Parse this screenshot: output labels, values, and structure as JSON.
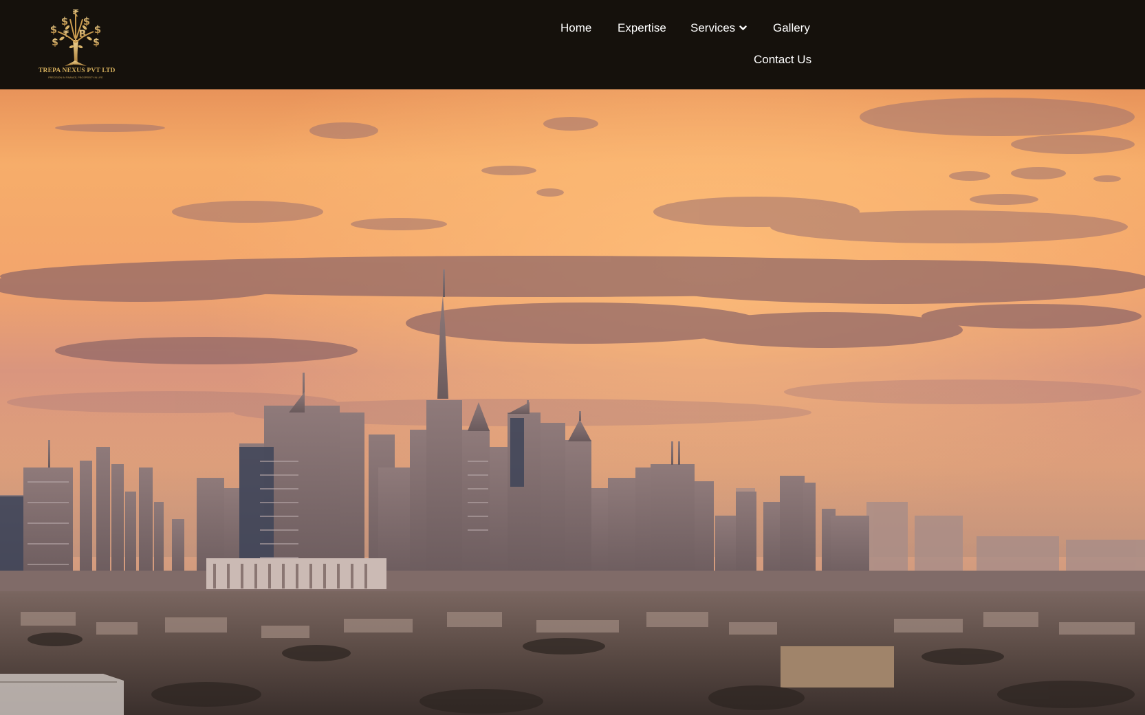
{
  "brand": {
    "name": "TREPA NEXUS PVT LTD",
    "tagline": "PRECISION IN FINANCE, PROSPERITY IN LIFE",
    "logo_icon": "money-tree-icon",
    "gold_color": "#d2ad5c"
  },
  "nav": {
    "home": "Home",
    "expertise": "Expertise",
    "services": "Services",
    "services_icon": "chevron-down-icon",
    "gallery": "Gallery",
    "contact": "Contact Us"
  },
  "hero": {
    "image": "city-skyline-sunset",
    "sky_color": "#f5a866",
    "haze_color": "#c99a78"
  },
  "colors": {
    "header_bg": "#15110c",
    "nav_text": "#ffffff"
  }
}
